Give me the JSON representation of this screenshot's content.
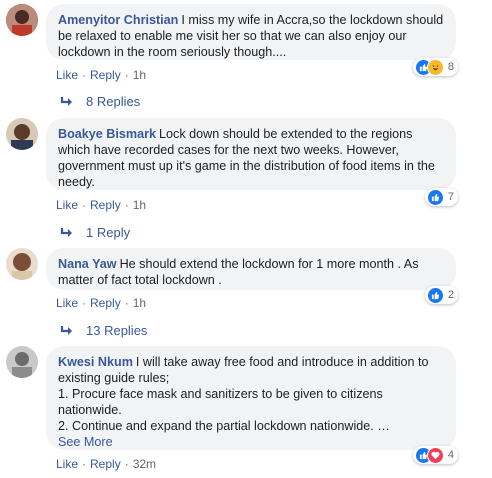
{
  "comments": [
    {
      "author": "Amenyitor Christian",
      "text": "I miss my wife in Accra,so the lockdown should be relaxed to enable me visit her so that we can also enjoy our lockdown in the room seriously though....",
      "reactions": [
        "like-icon",
        "haha-icon"
      ],
      "reaction_count": "8",
      "like_label": "Like",
      "reply_label": "Reply",
      "time": "1h",
      "replies_label": "8 Replies"
    },
    {
      "author": "Boakye Bismark",
      "text": "Lock down should be extended to the regions which have recorded cases for the next two weeks. However, government must up it's game in the distribution of food items in the needy.",
      "reactions": [
        "like-icon"
      ],
      "reaction_count": "7",
      "like_label": "Like",
      "reply_label": "Reply",
      "time": "1h",
      "replies_label": "1 Reply"
    },
    {
      "author": "Nana Yaw",
      "text": "He should extend the lockdown for 1 more month . As matter of fact total lockdown .",
      "reactions": [
        "like-icon"
      ],
      "reaction_count": "2",
      "like_label": "Like",
      "reply_label": "Reply",
      "time": "1h",
      "replies_label": "13 Replies"
    },
    {
      "author": "Kwesi Nkum",
      "text": "I will take away free food and introduce in addition to existing guide rules;\n1. Procure face mask and sanitizers to be given to citizens nationwide.\n2. Continue and expand the partial lockdown nationwide. …",
      "see_more": "See More",
      "reactions": [
        "like-icon",
        "love-icon"
      ],
      "reaction_count": "4",
      "like_label": "Like",
      "reply_label": "Reply",
      "time": "32m"
    }
  ],
  "colors": {
    "link": "#385898",
    "bubble": "#f2f3f5",
    "meta": "#606770",
    "like": "#1877f2"
  }
}
